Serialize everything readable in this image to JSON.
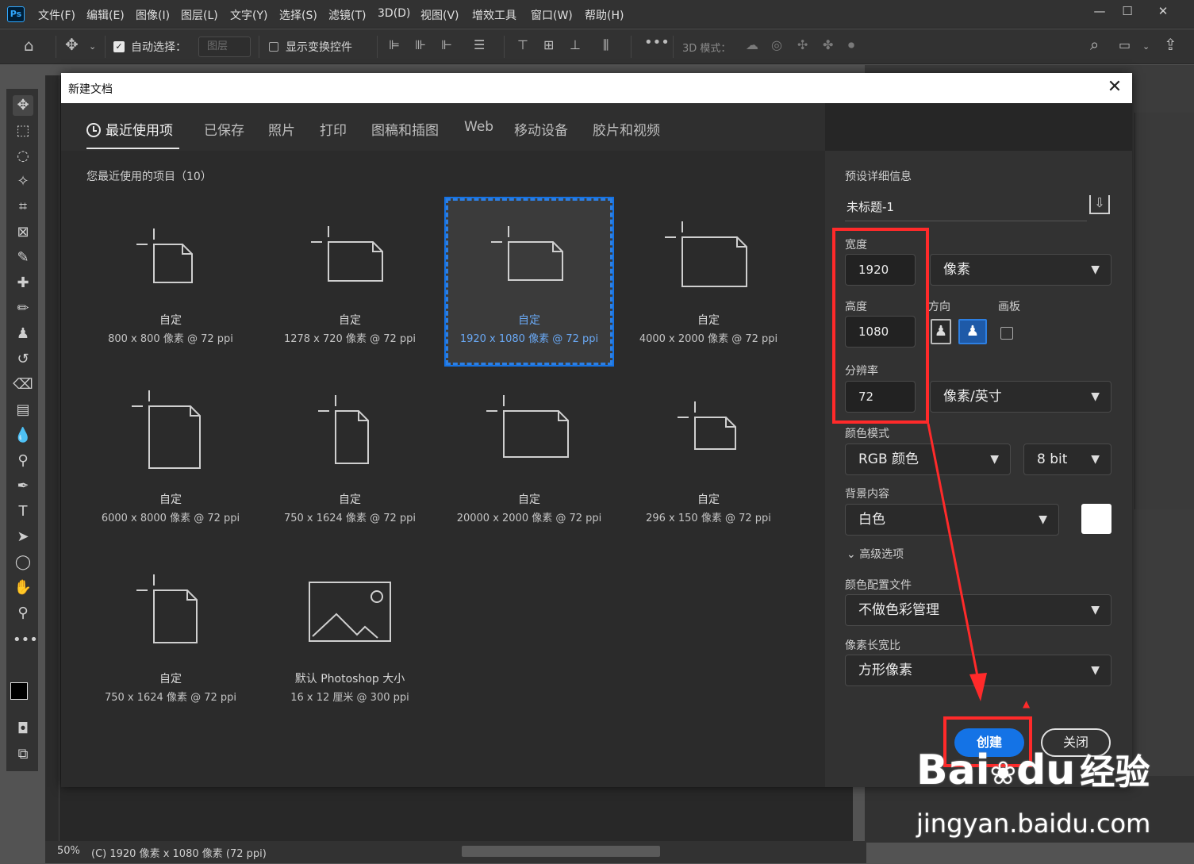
{
  "menubar": {
    "logo": "Ps",
    "items": [
      "文件(F)",
      "编辑(E)",
      "图像(I)",
      "图层(L)",
      "文字(Y)",
      "选择(S)",
      "滤镜(T)",
      "3D(D)",
      "视图(V)",
      "增效工具",
      "窗口(W)",
      "帮助(H)"
    ],
    "window_buttons": [
      "—",
      "☐",
      "✕"
    ]
  },
  "options_bar": {
    "auto_select_label": "自动选择：",
    "auto_select_value": "图层",
    "show_transform_label": "显示变换控件",
    "mode3d_label": "3D 模式："
  },
  "dialog": {
    "title": "新建文档",
    "tabs": [
      "最近使用项",
      "已保存",
      "照片",
      "打印",
      "图稿和插图",
      "Web",
      "移动设备",
      "胶片和视频"
    ],
    "recent_title": "您最近使用的项目（10）",
    "presets": [
      {
        "name": "自定",
        "desc": "800 x 800 像素 @ 72 ppi",
        "selected": false
      },
      {
        "name": "自定",
        "desc": "1278 x 720 像素 @ 72 ppi",
        "selected": false
      },
      {
        "name": "自定",
        "desc": "1920 x 1080 像素 @ 72 ppi",
        "selected": true
      },
      {
        "name": "自定",
        "desc": "4000 x 2000 像素 @ 72 ppi",
        "selected": false
      },
      {
        "name": "自定",
        "desc": "6000 x 8000 像素 @ 72 ppi",
        "selected": false
      },
      {
        "name": "自定",
        "desc": "750 x 1624 像素 @ 72 ppi",
        "selected": false
      },
      {
        "name": "自定",
        "desc": "20000 x 2000 像素 @ 72 ppi",
        "selected": false
      },
      {
        "name": "自定",
        "desc": "296 x 150 像素 @ 72 ppi",
        "selected": false
      },
      {
        "name": "自定",
        "desc": "750 x 1624 像素 @ 72 ppi",
        "selected": false
      },
      {
        "name": "默认 Photoshop 大小",
        "desc": "16 x 12 厘米 @ 300 ppi",
        "selected": false
      }
    ],
    "details": {
      "header": "预设详细信息",
      "doc_name": "未标题-1",
      "width_label": "宽度",
      "width_value": "1920",
      "width_unit": "像素",
      "height_label": "高度",
      "height_value": "1080",
      "orientation_label": "方向",
      "artboard_label": "画板",
      "resolution_label": "分辨率",
      "resolution_value": "72",
      "resolution_unit": "像素/英寸",
      "color_mode_label": "颜色模式",
      "color_mode": "RGB 颜色",
      "bit_depth": "8 bit",
      "bg_label": "背景内容",
      "bg_value": "白色",
      "advanced_label": "高级选项",
      "color_profile_label": "颜色配置文件",
      "color_profile": "不做色彩管理",
      "pixel_aspect_label": "像素长宽比",
      "pixel_aspect": "方形像素",
      "create": "创建",
      "close": "关闭"
    }
  },
  "statusbar": {
    "zoom": "50%",
    "info": "(C) 1920 像素 x 1080 像素 (72 ppi)"
  },
  "watermark": {
    "brand": "Bai",
    "brand2": "du",
    "brand3": "经验",
    "url": "jingyan.baidu.com"
  },
  "colors": {
    "accent": "#1473e6",
    "annotation": "#ff2a2a",
    "dialog_bg": "#2b2b2b"
  }
}
